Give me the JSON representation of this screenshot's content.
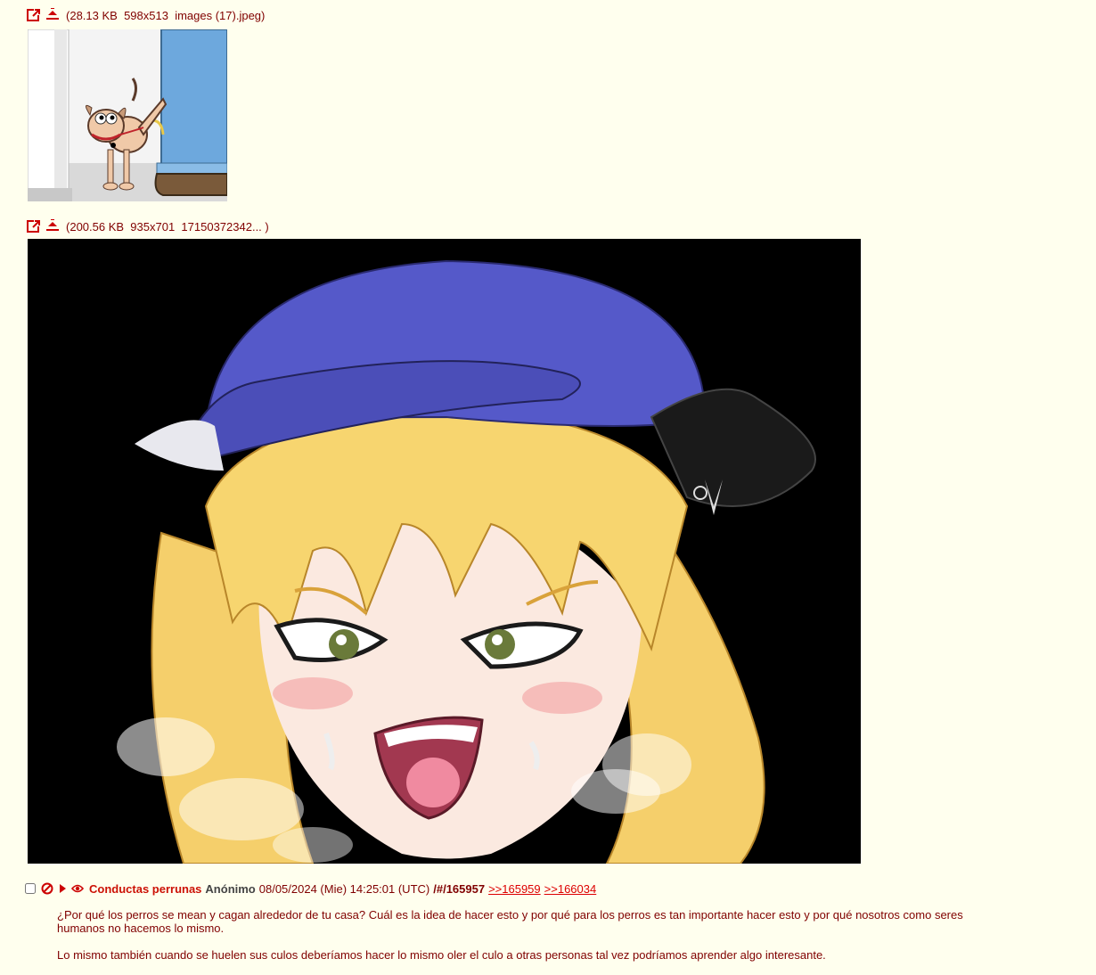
{
  "files": [
    {
      "size": "28.13 KB",
      "dimensions": "598x513",
      "filename": "images (17).jpeg",
      "open_icon": "external-link-icon",
      "download_icon": "download-icon"
    },
    {
      "size": "200.56 KB",
      "dimensions": "935x701",
      "filename": "17150372342... ",
      "open_icon": "external-link-icon",
      "download_icon": "download-icon"
    }
  ],
  "post": {
    "checkbox_checked": false,
    "subject": "Conductas perrunas",
    "name": "Anónimo",
    "datetime": "08/05/2024 (Mie) 14:25:01 (UTC)",
    "post_number": "/#/165957",
    "replies": [
      ">>165959",
      ">>166034"
    ],
    "body": [
      "¿Por qué los perros se mean y cagan alrededor de tu casa? Cuál es la idea de hacer esto y por qué para los perros es tan importante hacer esto y por qué nosotros como seres humanos no hacemos lo mismo.",
      "Lo mismo también cuando se huelen sus culos deberíamos hacer lo mismo oler el culo a otras personas tal vez podríamos aprender algo interesante."
    ]
  },
  "colors": {
    "background": "#ffffee",
    "text": "#800000",
    "subject": "#cc1105",
    "link": "#dd0000"
  }
}
